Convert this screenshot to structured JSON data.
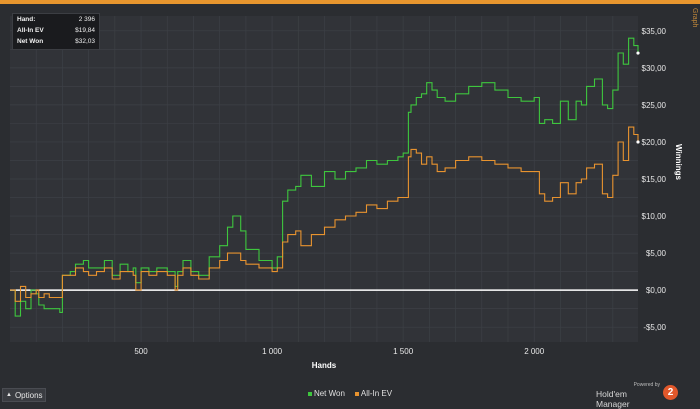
{
  "stats": {
    "rows": [
      {
        "label": "Hand:",
        "value": "2 396"
      },
      {
        "label": "All-In EV",
        "value": "$19,84"
      },
      {
        "label": "Net Won",
        "value": "$32,03"
      }
    ]
  },
  "options_label": "Options",
  "brand": {
    "powered_by": "Powered by",
    "name": "Hold'em Manager",
    "badge": "2"
  },
  "side_label": "Graph",
  "colors": {
    "net_won": "#3ec63e",
    "all_in_ev": "#e8932f",
    "zero_line": "#ffffff",
    "accent": "#e8962e"
  },
  "chart_data": {
    "type": "line",
    "xlabel": "Hands",
    "ylabel": "Winnings",
    "xlim": [
      0,
      2396
    ],
    "ylim": [
      -7,
      37
    ],
    "x_ticks": [
      500,
      1000,
      1500,
      2000
    ],
    "x_tick_labels": [
      "500",
      "1 000",
      "1 500",
      "2 000"
    ],
    "y_ticks": [
      -5,
      0,
      5,
      10,
      15,
      20,
      25,
      30,
      35
    ],
    "y_tick_labels": [
      "-$5,00",
      "$0,00",
      "$5,00",
      "$10,00",
      "$15,00",
      "$20,00",
      "$25,00",
      "$30,00",
      "$35,00"
    ],
    "grid": true,
    "legend": "bottom",
    "series": [
      {
        "name": "Net Won",
        "color": "#3ec63e",
        "x": [
          0,
          20,
          40,
          60,
          80,
          100,
          110,
          130,
          150,
          170,
          190,
          200,
          230,
          250,
          280,
          300,
          330,
          360,
          390,
          420,
          450,
          470,
          480,
          500,
          530,
          560,
          600,
          630,
          640,
          660,
          690,
          720,
          760,
          800,
          830,
          850,
          880,
          900,
          950,
          1000,
          1020,
          1040,
          1060,
          1090,
          1110,
          1150,
          1200,
          1240,
          1280,
          1320,
          1360,
          1400,
          1440,
          1480,
          1500,
          1520,
          1530,
          1550,
          1570,
          1590,
          1610,
          1630,
          1660,
          1700,
          1750,
          1800,
          1850,
          1900,
          1950,
          2000,
          2020,
          2040,
          2070,
          2100,
          2130,
          2160,
          2180,
          2200,
          2230,
          2260,
          2280,
          2300,
          2320,
          2340,
          2360,
          2380,
          2396
        ],
        "values": [
          0,
          -3.5,
          -1.5,
          -2.5,
          0,
          -0.5,
          -2,
          -2.5,
          -2.5,
          -2.5,
          -3,
          2,
          2.5,
          3.5,
          4,
          3,
          3,
          4,
          2,
          3.5,
          2.5,
          3,
          1,
          3,
          2.5,
          3,
          2.5,
          0.5,
          2.5,
          4,
          2.5,
          2,
          4.5,
          6,
          8.5,
          10,
          8,
          5.5,
          4,
          3,
          4.5,
          12,
          13.5,
          14,
          15.5,
          14,
          16,
          15,
          16,
          16.5,
          17.5,
          17,
          17.5,
          18,
          18.5,
          24,
          25,
          26,
          26.5,
          28,
          27,
          26,
          25.5,
          26.5,
          27.5,
          28,
          27,
          26,
          25.5,
          26,
          22.5,
          23,
          22.5,
          25.5,
          23,
          25.5,
          25,
          27.5,
          28.5,
          25,
          24.5,
          27,
          32,
          30.5,
          34,
          33,
          32
        ]
      },
      {
        "name": "All-In EV",
        "color": "#e8932f",
        "x": [
          0,
          20,
          40,
          60,
          80,
          100,
          110,
          130,
          150,
          170,
          190,
          200,
          230,
          250,
          280,
          300,
          330,
          360,
          390,
          420,
          450,
          470,
          480,
          500,
          530,
          560,
          600,
          630,
          640,
          660,
          690,
          720,
          760,
          800,
          830,
          850,
          880,
          900,
          950,
          1000,
          1020,
          1040,
          1060,
          1090,
          1110,
          1150,
          1200,
          1240,
          1280,
          1320,
          1360,
          1400,
          1440,
          1480,
          1500,
          1520,
          1530,
          1550,
          1570,
          1590,
          1610,
          1630,
          1660,
          1700,
          1750,
          1800,
          1850,
          1900,
          1950,
          2000,
          2020,
          2040,
          2070,
          2100,
          2130,
          2160,
          2180,
          2200,
          2230,
          2260,
          2280,
          2300,
          2320,
          2340,
          2360,
          2380,
          2396
        ],
        "values": [
          0,
          -1.5,
          0.5,
          -1,
          -0.5,
          0,
          -1,
          -0.5,
          -1,
          -1,
          -1,
          2,
          2,
          3,
          2.5,
          2,
          2.5,
          3,
          1.5,
          2.5,
          2.5,
          2,
          0,
          2.5,
          2,
          2.5,
          2,
          0,
          2,
          3,
          2,
          1.5,
          3,
          4,
          5,
          5,
          4,
          3.5,
          3,
          2.5,
          3,
          6.5,
          7.5,
          8,
          6,
          7.5,
          8.5,
          9.5,
          10,
          10.5,
          11.5,
          11,
          12,
          12.5,
          12.5,
          18,
          19,
          18.5,
          17,
          18,
          17,
          16,
          16.5,
          17.5,
          18,
          17.5,
          17,
          16.5,
          16,
          16,
          13,
          12,
          12.5,
          14.5,
          13,
          14.5,
          15,
          16.5,
          17,
          13,
          12.5,
          15.5,
          20,
          17.5,
          22,
          21,
          20
        ]
      }
    ]
  }
}
